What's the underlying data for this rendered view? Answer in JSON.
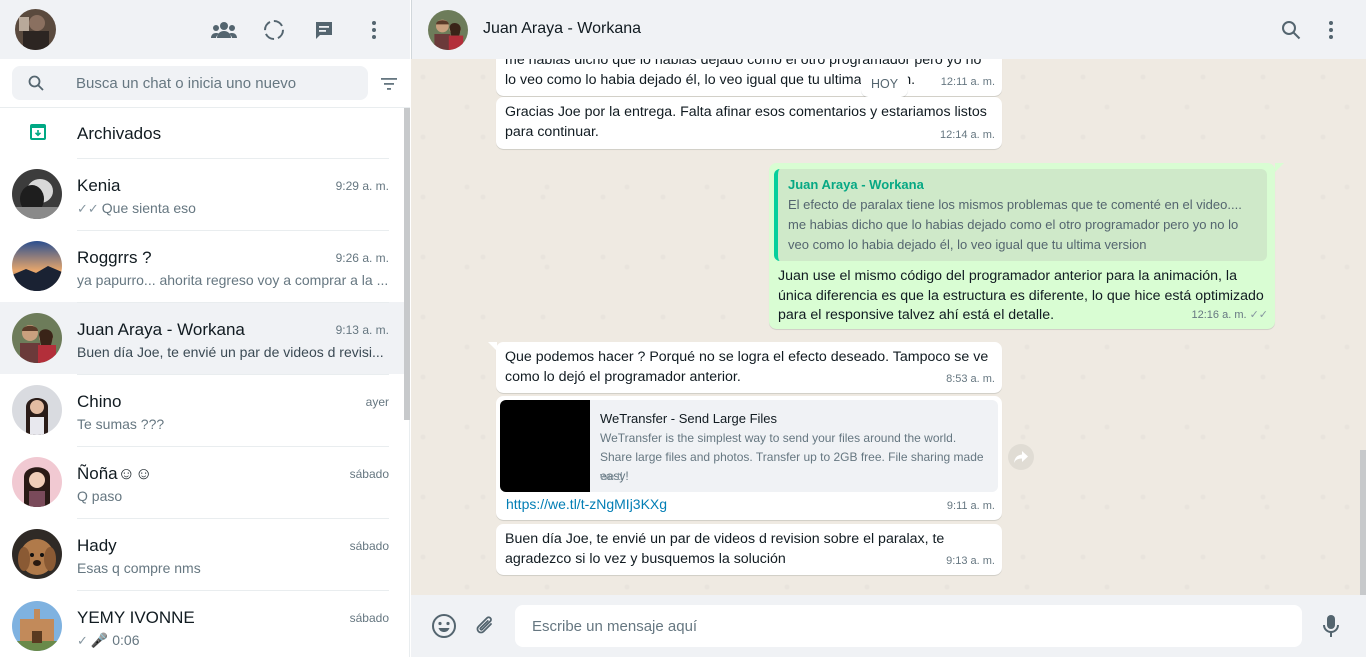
{
  "colors": {
    "accent": "#00a884",
    "outgoing_bubble": "#d9fdd3",
    "link": "#027eb5",
    "panel": "#f0f2f5",
    "chat_bg": "#efeae2"
  },
  "sidebar": {
    "header_icons": [
      "communities-icon",
      "status-icon",
      "new-chat-icon",
      "menu-icon"
    ],
    "search": {
      "placeholder": "Busca un chat o inicia uno nuevo"
    },
    "archived_label": "Archivados",
    "chats": [
      {
        "name": "Kenia",
        "time": "9:29 a. m.",
        "tick": "✓✓",
        "preview": "Que sienta eso"
      },
      {
        "name": "Roggrrs ?",
        "time": "9:26 a. m.",
        "tick": "",
        "preview": "ya papurro... ahorita regreso voy a comprar a la ..."
      },
      {
        "name": "Juan Araya - Workana",
        "time": "9:13 a. m.",
        "tick": "",
        "preview": "Buen día Joe, te envié un par de videos d revisi..."
      },
      {
        "name": "Chino",
        "time": "ayer",
        "tick": "",
        "preview": "Te sumas ???"
      },
      {
        "name": "Ñoña☺☺",
        "time": "sábado",
        "tick": "",
        "preview": "Q paso"
      },
      {
        "name": "Hady",
        "time": "sábado",
        "tick": "",
        "preview": "Esas q compre nms"
      },
      {
        "name": "YEMY IVONNE",
        "time": "sábado",
        "tick": "✓",
        "preview": "🎤 0:06"
      }
    ]
  },
  "conversation": {
    "contact_name": "Juan Araya - Workana",
    "date_divider": "HOY",
    "messages": [
      {
        "text": "me habias dicho que lo habias dejado como el otro programador pero yo no lo veo como lo habia dejado él, lo veo igual que tu ultima version.",
        "time": "12:11 a. m."
      },
      {
        "text": "Gracias Joe por la entrega. Falta afinar esos comentarios y estariamos listos para continuar.",
        "time": "12:14 a. m."
      },
      {
        "quote_author": "Juan Araya - Workana",
        "quote_text": "El efecto de paralax tiene los mismos problemas que te comenté en el video.... me habias dicho que lo habias dejado como el otro programador pero yo no lo veo como lo habia dejado él, lo veo igual que tu ultima version",
        "text": "Juan use el mismo código del programador anterior para la animación, la única diferencia es que la estructura es diferente, lo que hice está optimizado para el responsive talvez ahí está el detalle.",
        "time": "12:16 a. m.",
        "tick": "✓✓"
      },
      {
        "text": "Que podemos hacer ? Porqué no se logra el efecto deseado. Tampoco se ve como lo dejó el programador anterior.",
        "time": "8:53 a. m."
      },
      {
        "link_title": "WeTransfer - Send Large Files",
        "link_desc": "WeTransfer is the simplest way to send your files around the world. Share large files and photos. Transfer up to 2GB free. File sharing made easy!",
        "link_domain": "we.tl",
        "url": "https://we.tl/t-zNgMIj3KXg",
        "time": "9:11 a. m."
      },
      {
        "text": "Buen día Joe, te envié un par de videos d revision sobre el paralax, te agradezco si lo vez y busquemos la solución",
        "time": "9:13 a. m."
      }
    ]
  },
  "composer": {
    "placeholder": "Escribe un mensaje aquí"
  }
}
